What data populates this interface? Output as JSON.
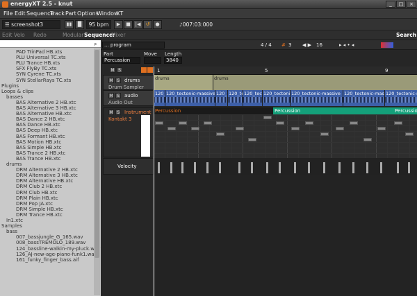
{
  "window": {
    "title": "energyXT 2.5 - knut",
    "btn_min": "_",
    "btn_max": "□",
    "btn_close": "×"
  },
  "menu": [
    "File",
    "Edit",
    "Sequence",
    "Track",
    "Part",
    "Options",
    "Window",
    "XT"
  ],
  "toolbar": {
    "project": "screenshot3",
    "bpm": "95 bpm",
    "position": "007:03:000"
  },
  "subtoolbar": {
    "edit": "Edit Velo",
    "redo": "Redo",
    "modular": "Modular",
    "sequencer": "Sequencer",
    "mixer": "Mixer",
    "search": "Search"
  },
  "sidebar": {
    "items": [
      {
        "label": "PAD TrinPad HB.xts",
        "indent": 3
      },
      {
        "label": "PLU Universal TC.xts",
        "indent": 3
      },
      {
        "label": "PLU Trance HB.xts",
        "indent": 3
      },
      {
        "label": "SFX FlyBy TC.xts",
        "indent": 3
      },
      {
        "label": "SYN Cyrene TC.xts",
        "indent": 3
      },
      {
        "label": "SYN StellarRays TC.xts",
        "indent": 3
      },
      {
        "label": "Plugins",
        "indent": 0
      },
      {
        "label": "Loops & clips",
        "indent": 0
      },
      {
        "label": "basses",
        "indent": 1
      },
      {
        "label": "BAS Alternative 2 HB.xtc",
        "indent": 3
      },
      {
        "label": "BAS Alternative 3 HB.xtc",
        "indent": 3
      },
      {
        "label": "BAS Alternative HB.xtc",
        "indent": 3
      },
      {
        "label": "BAS Dance 2 HB.xtc",
        "indent": 3
      },
      {
        "label": "BAS Dance HB.xtc",
        "indent": 3
      },
      {
        "label": "BAS Deep HB.xtc",
        "indent": 3
      },
      {
        "label": "BAS Formant HB.xtc",
        "indent": 3
      },
      {
        "label": "BAS Motion HB.xtc",
        "indent": 3
      },
      {
        "label": "BAS Simple HB.xtc",
        "indent": 3
      },
      {
        "label": "BAS Trance 2 HB.xtc",
        "indent": 3
      },
      {
        "label": "BAS Trance HB.xtc",
        "indent": 3
      },
      {
        "label": "drums",
        "indent": 1
      },
      {
        "label": "DRM Alternative 2 HB.xtc",
        "indent": 3
      },
      {
        "label": "DRM Alternative 3 HB.xtc",
        "indent": 3
      },
      {
        "label": "DRM Alternative HB.xtc",
        "indent": 3
      },
      {
        "label": "DRM Club 2 HB.xtc",
        "indent": 3
      },
      {
        "label": "DRM Club HB.xtc",
        "indent": 3
      },
      {
        "label": "DRM Plain HB.xtc",
        "indent": 3
      },
      {
        "label": "DRM Pop JA.xtc",
        "indent": 3
      },
      {
        "label": "DRM Simple HB.xtc",
        "indent": 3
      },
      {
        "label": "DRM Trance HB.xtc",
        "indent": 3
      },
      {
        "label": "In1.xtc",
        "indent": 1
      },
      {
        "label": "Samples",
        "indent": 0
      },
      {
        "label": "bass",
        "indent": 1
      },
      {
        "label": "007_bassjungle_G_165.wav",
        "indent": 3
      },
      {
        "label": "008_bassTREMOLO_189.wav",
        "indent": 3
      },
      {
        "label": "124_bassline-walkin-my-pluck.wav",
        "indent": 3
      },
      {
        "label": "126_AJ-new-age-piano-funk1.wav",
        "indent": 3
      },
      {
        "label": "161_funky_finger_bass.aif",
        "indent": 3
      }
    ]
  },
  "seq": {
    "program": "... program",
    "pos": "4 / 4",
    "grid": "16",
    "part_label": "Part",
    "part_value": "Percussion",
    "move_label": "Move",
    "length_label": "Length",
    "length_value": "3840",
    "ruler": [
      "1",
      "5",
      "9"
    ],
    "tracks": {
      "drums": "drums",
      "drum_sampler": "Drum Sampler",
      "audio": "audio",
      "audio_out": "Audio Out",
      "instrument": "Instrument",
      "kontakt": "Kontakt 3",
      "velocity": "Velocity"
    },
    "clips": {
      "drums1": "drums",
      "drums2": "drums",
      "audio": [
        "120_t",
        "120_tectonic-massive",
        "120_tec",
        "120_tec",
        "120_tecto",
        "120_tectonic",
        "120_tectonic-massive",
        "120_tectonic-massive",
        "120_tectonic-massive"
      ],
      "perc1": "Percussion",
      "perc2": "Percussion",
      "perc3": "Percussion"
    }
  },
  "colors": {
    "accent": "#e07020",
    "audio": "#3d5fa8",
    "drums": "#8a8a6a",
    "perc_active": "#1a1a1a",
    "perc_teal": "#14a07a"
  }
}
